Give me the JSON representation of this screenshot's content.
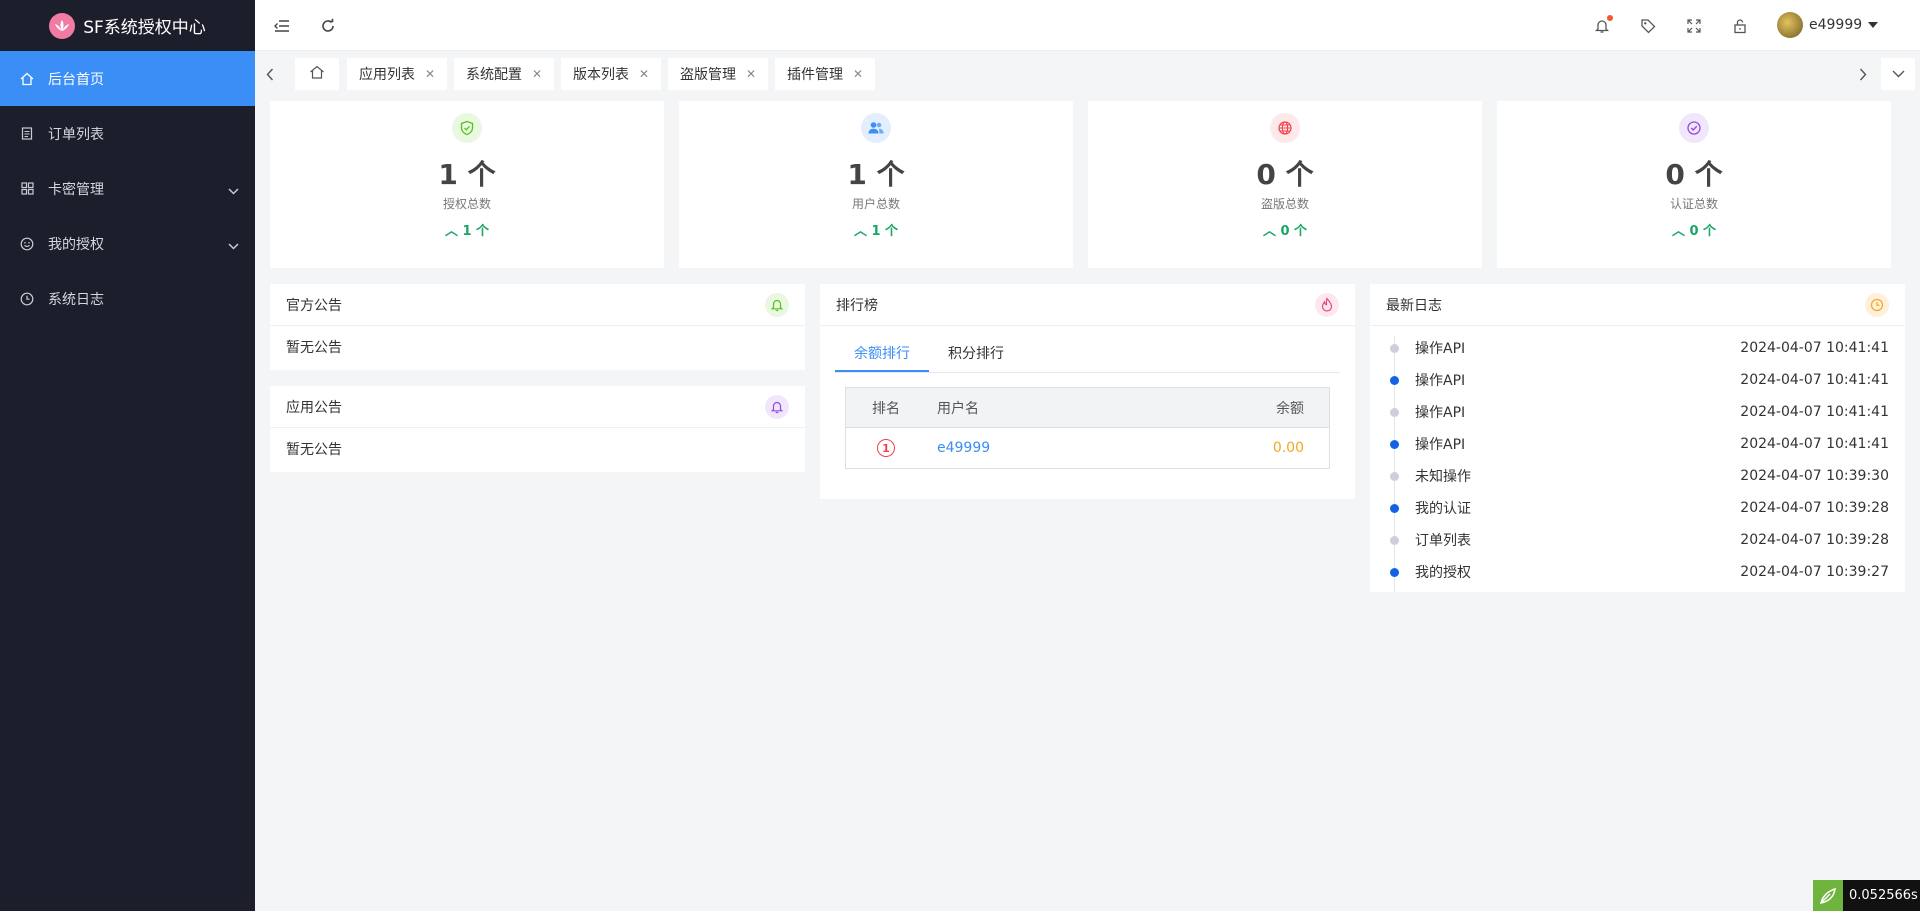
{
  "app": {
    "title": "SF系统授权中心",
    "logo_glyph": "SF"
  },
  "sidebar": {
    "items": [
      {
        "label": "后台首页",
        "icon": "home-icon"
      },
      {
        "label": "订单列表",
        "icon": "document-icon"
      },
      {
        "label": "卡密管理",
        "icon": "grid-icon"
      },
      {
        "label": "我的授权",
        "icon": "smile-icon"
      },
      {
        "label": "系统日志",
        "icon": "clock-icon"
      }
    ]
  },
  "header": {
    "username": "e49999"
  },
  "tabs": [
    {
      "label": "应用列表"
    },
    {
      "label": "系统配置"
    },
    {
      "label": "版本列表"
    },
    {
      "label": "盗版管理"
    },
    {
      "label": "插件管理"
    }
  ],
  "stats": [
    {
      "value": "1 个",
      "label": "授权总数",
      "trend": "1 个",
      "color": "#52c41a"
    },
    {
      "value": "1 个",
      "label": "用户总数",
      "trend": "1 个",
      "color": "#3a8ef6"
    },
    {
      "value": "0 个",
      "label": "盗版总数",
      "trend": "0 个",
      "color": "#f0414e"
    },
    {
      "value": "0 个",
      "label": "认证总数",
      "trend": "0 个",
      "color": "#8f4ddf"
    }
  ],
  "notices": {
    "official": {
      "title": "官方公告",
      "body": "暂无公告"
    },
    "app": {
      "title": "应用公告",
      "body": "暂无公告"
    }
  },
  "rank": {
    "title": "排行榜",
    "tabs": [
      "余额排行",
      "积分排行"
    ],
    "headers": {
      "rank": "排名",
      "user": "用户名",
      "balance": "余额"
    },
    "rows": [
      {
        "rank": "1",
        "user": "e49999",
        "balance": "0.00"
      }
    ]
  },
  "logs": {
    "title": "最新日志",
    "items": [
      {
        "action": "操作API",
        "time": "2024-04-07 10:41:41",
        "highlight": false
      },
      {
        "action": "操作API",
        "time": "2024-04-07 10:41:41",
        "highlight": true
      },
      {
        "action": "操作API",
        "time": "2024-04-07 10:41:41",
        "highlight": false
      },
      {
        "action": "操作API",
        "time": "2024-04-07 10:41:41",
        "highlight": true
      },
      {
        "action": "未知操作",
        "time": "2024-04-07 10:39:30",
        "highlight": false
      },
      {
        "action": "我的认证",
        "time": "2024-04-07 10:39:28",
        "highlight": true
      },
      {
        "action": "订单列表",
        "time": "2024-04-07 10:39:28",
        "highlight": false
      },
      {
        "action": "我的授权",
        "time": "2024-04-07 10:39:27",
        "highlight": true
      }
    ]
  },
  "perf": {
    "time": "0.052566s"
  }
}
